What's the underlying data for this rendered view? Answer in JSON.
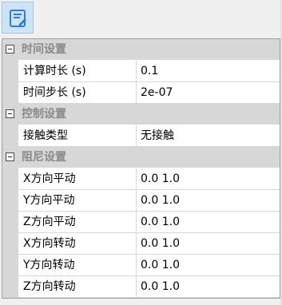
{
  "toolbar": {
    "button_icon": "edit-document-icon",
    "accent_color": "#2a7fd4"
  },
  "property_grid": {
    "sections": [
      {
        "label": "时间设置",
        "items": [
          {
            "name": "计算时长 (s)",
            "value": "0.1"
          },
          {
            "name": "时间步长 (s)",
            "value": "2e-07"
          }
        ]
      },
      {
        "label": "控制设置",
        "items": [
          {
            "name": "接触类型",
            "value": "无接触"
          }
        ]
      },
      {
        "label": "阻尼设置",
        "items": [
          {
            "name": "X方向平动",
            "value": "0.0 1.0"
          },
          {
            "name": "Y方向平动",
            "value": "0.0 1.0"
          },
          {
            "name": "Z方向平动",
            "value": "0.0 1.0"
          },
          {
            "name": "X方向转动",
            "value": "0.0 1.0"
          },
          {
            "name": "Y方向转动",
            "value": "0.0 1.0"
          },
          {
            "name": "Z方向转动",
            "value": "0.0 1.0"
          }
        ]
      }
    ]
  }
}
